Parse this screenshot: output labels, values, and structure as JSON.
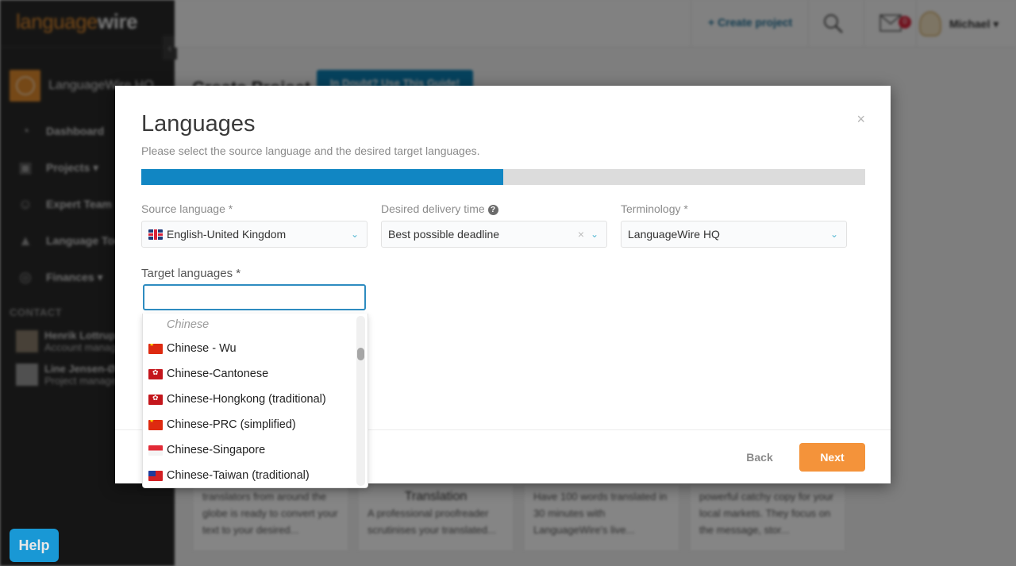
{
  "brand": {
    "part1": "language",
    "part2": "wire"
  },
  "sidebar": {
    "org_name": "LanguageWire HQ",
    "items": [
      {
        "label": "Dashboard",
        "icon": "gauge-icon"
      },
      {
        "label": "Projects ▾",
        "icon": "projects-icon"
      },
      {
        "label": "Expert Team",
        "icon": "team-icon"
      },
      {
        "label": "Language Tools",
        "icon": "tools-icon"
      },
      {
        "label": "Finances ▾",
        "icon": "coins-icon"
      }
    ],
    "contact_title": "CONTACT",
    "contacts": [
      {
        "name": "Henrik Lottrup",
        "role": "Account manager"
      },
      {
        "name": "Line Jensen-Ø",
        "role": "Project manager"
      }
    ],
    "help_label": "Help"
  },
  "topbar": {
    "create_label": "+ Create project",
    "mail_count": "0",
    "user_name": "Michael ▾"
  },
  "page": {
    "title": "Create Project",
    "guide_label": "In Doubt? Use This Guide!"
  },
  "cards": [
    {
      "title": "",
      "text": "translators from around the globe is ready to convert your text to your desired..."
    },
    {
      "title": "Translation",
      "text": "A professional proofreader scrutinises your translated..."
    },
    {
      "title": "",
      "text": "Have 100 words translated in 30 minutes with LanguageWire's live..."
    },
    {
      "title": "",
      "text": "powerful catchy copy for your local markets. They focus on the message, stor..."
    }
  ],
  "modal": {
    "title": "Languages",
    "subtitle": "Please select the source language and the desired target languages.",
    "progress": 0.5,
    "close_icon": "×",
    "source": {
      "label": "Source language *",
      "value": "English-United Kingdom",
      "flag": "gb"
    },
    "delivery": {
      "label": "Desired delivery time",
      "help_icon": "?",
      "value": "Best possible deadline",
      "clear_icon": "×"
    },
    "terminology": {
      "label": "Terminology *",
      "value": "LanguageWire HQ"
    },
    "chevron_icon": "⌄",
    "target": {
      "label": "Target languages *",
      "value": "",
      "placeholder": ""
    },
    "back_label": "Back",
    "next_label": "Next"
  },
  "dropdown": {
    "scroll_position": 0.2,
    "options": [
      {
        "label": "Chinese",
        "flag": "none",
        "group": true
      },
      {
        "label": "Chinese - Wu",
        "flag": "cn"
      },
      {
        "label": "Chinese-Cantonese",
        "flag": "hk"
      },
      {
        "label": "Chinese-Hongkong (traditional)",
        "flag": "hk"
      },
      {
        "label": "Chinese-PRC (simplified)",
        "flag": "cn"
      },
      {
        "label": "Chinese-Singapore",
        "flag": "sg"
      },
      {
        "label": "Chinese-Taiwan (traditional)",
        "flag": "tw"
      }
    ]
  },
  "colors": {
    "accent_orange": "#f4933a",
    "progress_blue": "#1186c3",
    "brand_orange": "#e08a2c",
    "help_blue": "#1aa7ea"
  }
}
